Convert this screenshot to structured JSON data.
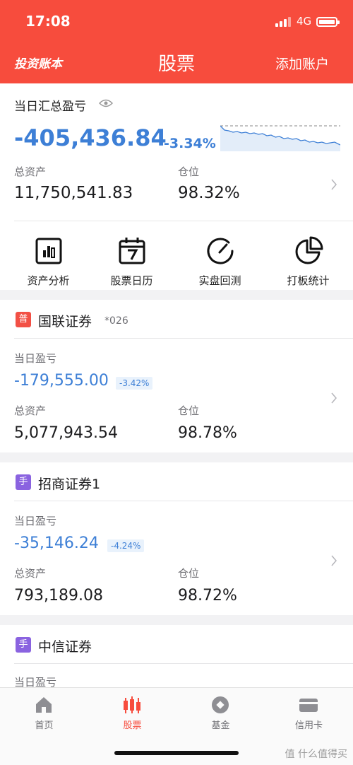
{
  "status_bar": {
    "time": "17:08",
    "network": "4G"
  },
  "nav": {
    "left": "投资账本",
    "title": "股票",
    "right": "添加账户"
  },
  "summary": {
    "title": "当日汇总盈亏",
    "pnl": "-405,436.84",
    "pct": "-3.34%",
    "total_assets_label": "总资产",
    "total_assets": "11,750,541.83",
    "position_label": "仓位",
    "position": "98.32%"
  },
  "tools": [
    {
      "label": "资产分析",
      "icon": "bar-chart-box-icon"
    },
    {
      "label": "股票日历",
      "icon": "calendar-7-icon"
    },
    {
      "label": "实盘回测",
      "icon": "gauge-icon"
    },
    {
      "label": "打板统计",
      "icon": "pie-chart-icon"
    }
  ],
  "accounts": [
    {
      "badge": "普",
      "badge_color": "#f25045",
      "broker": "国联证券",
      "acct": "*026",
      "pnl_label": "当日盈亏",
      "pnl": "-179,555.00",
      "pct": "-3.42%",
      "assets_label": "总资产",
      "assets": "5,077,943.54",
      "position_label": "仓位",
      "position": "98.78%"
    },
    {
      "badge": "手",
      "badge_color": "#8a63e0",
      "broker": "招商证券1",
      "acct": "",
      "pnl_label": "当日盈亏",
      "pnl": "-35,146.24",
      "pct": "-4.24%",
      "assets_label": "总资产",
      "assets": "793,189.08",
      "position_label": "仓位",
      "position": "98.72%"
    },
    {
      "badge": "手",
      "badge_color": "#8a63e0",
      "broker": "中信证券",
      "acct": "",
      "pnl_label": "当日盈亏"
    }
  ],
  "tabs": [
    {
      "label": "首页",
      "icon": "home-icon"
    },
    {
      "label": "股票",
      "icon": "candlestick-icon",
      "active": true
    },
    {
      "label": "基金",
      "icon": "fund-circle-icon"
    },
    {
      "label": "信用卡",
      "icon": "credit-card-icon"
    }
  ],
  "watermark": "值 什么值得买",
  "colors": {
    "brand": "#f74c3d",
    "loss_blue": "#3d7fd6"
  }
}
